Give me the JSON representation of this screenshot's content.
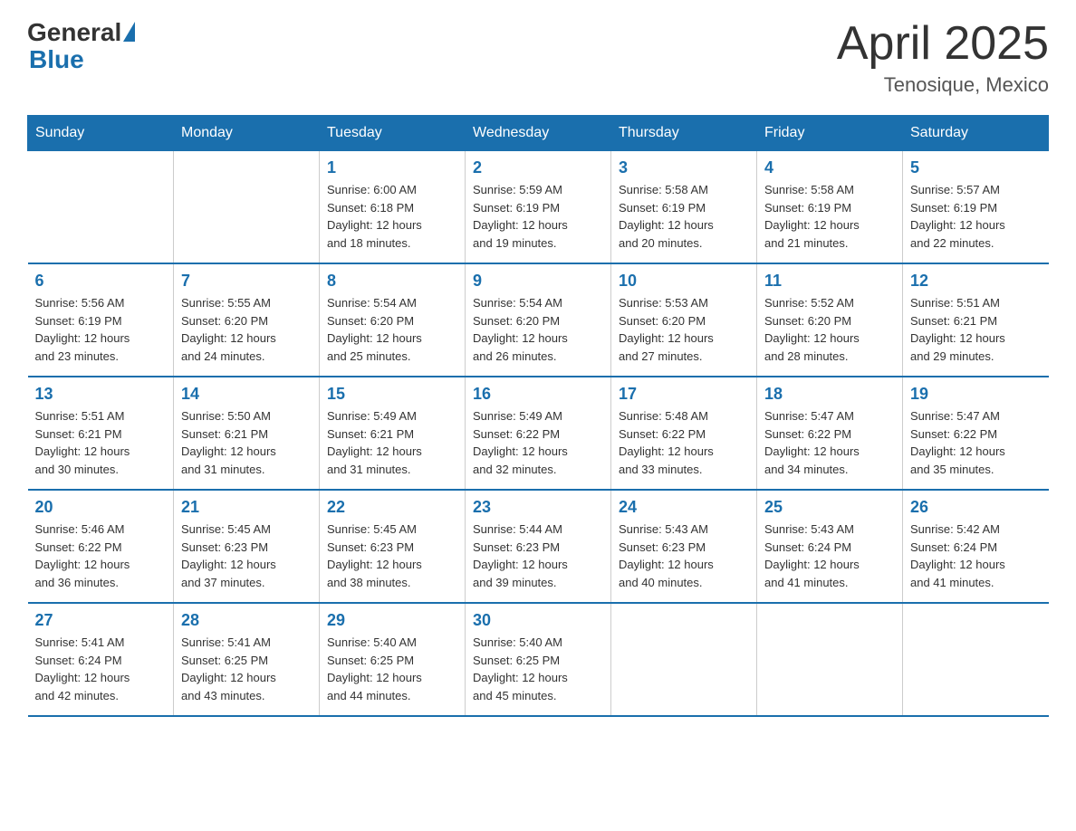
{
  "logo": {
    "general": "General",
    "blue": "Blue"
  },
  "header": {
    "title": "April 2025",
    "subtitle": "Tenosique, Mexico"
  },
  "weekdays": [
    "Sunday",
    "Monday",
    "Tuesday",
    "Wednesday",
    "Thursday",
    "Friday",
    "Saturday"
  ],
  "weeks": [
    [
      {
        "day": "",
        "info": ""
      },
      {
        "day": "",
        "info": ""
      },
      {
        "day": "1",
        "info": "Sunrise: 6:00 AM\nSunset: 6:18 PM\nDaylight: 12 hours\nand 18 minutes."
      },
      {
        "day": "2",
        "info": "Sunrise: 5:59 AM\nSunset: 6:19 PM\nDaylight: 12 hours\nand 19 minutes."
      },
      {
        "day": "3",
        "info": "Sunrise: 5:58 AM\nSunset: 6:19 PM\nDaylight: 12 hours\nand 20 minutes."
      },
      {
        "day": "4",
        "info": "Sunrise: 5:58 AM\nSunset: 6:19 PM\nDaylight: 12 hours\nand 21 minutes."
      },
      {
        "day": "5",
        "info": "Sunrise: 5:57 AM\nSunset: 6:19 PM\nDaylight: 12 hours\nand 22 minutes."
      }
    ],
    [
      {
        "day": "6",
        "info": "Sunrise: 5:56 AM\nSunset: 6:19 PM\nDaylight: 12 hours\nand 23 minutes."
      },
      {
        "day": "7",
        "info": "Sunrise: 5:55 AM\nSunset: 6:20 PM\nDaylight: 12 hours\nand 24 minutes."
      },
      {
        "day": "8",
        "info": "Sunrise: 5:54 AM\nSunset: 6:20 PM\nDaylight: 12 hours\nand 25 minutes."
      },
      {
        "day": "9",
        "info": "Sunrise: 5:54 AM\nSunset: 6:20 PM\nDaylight: 12 hours\nand 26 minutes."
      },
      {
        "day": "10",
        "info": "Sunrise: 5:53 AM\nSunset: 6:20 PM\nDaylight: 12 hours\nand 27 minutes."
      },
      {
        "day": "11",
        "info": "Sunrise: 5:52 AM\nSunset: 6:20 PM\nDaylight: 12 hours\nand 28 minutes."
      },
      {
        "day": "12",
        "info": "Sunrise: 5:51 AM\nSunset: 6:21 PM\nDaylight: 12 hours\nand 29 minutes."
      }
    ],
    [
      {
        "day": "13",
        "info": "Sunrise: 5:51 AM\nSunset: 6:21 PM\nDaylight: 12 hours\nand 30 minutes."
      },
      {
        "day": "14",
        "info": "Sunrise: 5:50 AM\nSunset: 6:21 PM\nDaylight: 12 hours\nand 31 minutes."
      },
      {
        "day": "15",
        "info": "Sunrise: 5:49 AM\nSunset: 6:21 PM\nDaylight: 12 hours\nand 31 minutes."
      },
      {
        "day": "16",
        "info": "Sunrise: 5:49 AM\nSunset: 6:22 PM\nDaylight: 12 hours\nand 32 minutes."
      },
      {
        "day": "17",
        "info": "Sunrise: 5:48 AM\nSunset: 6:22 PM\nDaylight: 12 hours\nand 33 minutes."
      },
      {
        "day": "18",
        "info": "Sunrise: 5:47 AM\nSunset: 6:22 PM\nDaylight: 12 hours\nand 34 minutes."
      },
      {
        "day": "19",
        "info": "Sunrise: 5:47 AM\nSunset: 6:22 PM\nDaylight: 12 hours\nand 35 minutes."
      }
    ],
    [
      {
        "day": "20",
        "info": "Sunrise: 5:46 AM\nSunset: 6:22 PM\nDaylight: 12 hours\nand 36 minutes."
      },
      {
        "day": "21",
        "info": "Sunrise: 5:45 AM\nSunset: 6:23 PM\nDaylight: 12 hours\nand 37 minutes."
      },
      {
        "day": "22",
        "info": "Sunrise: 5:45 AM\nSunset: 6:23 PM\nDaylight: 12 hours\nand 38 minutes."
      },
      {
        "day": "23",
        "info": "Sunrise: 5:44 AM\nSunset: 6:23 PM\nDaylight: 12 hours\nand 39 minutes."
      },
      {
        "day": "24",
        "info": "Sunrise: 5:43 AM\nSunset: 6:23 PM\nDaylight: 12 hours\nand 40 minutes."
      },
      {
        "day": "25",
        "info": "Sunrise: 5:43 AM\nSunset: 6:24 PM\nDaylight: 12 hours\nand 41 minutes."
      },
      {
        "day": "26",
        "info": "Sunrise: 5:42 AM\nSunset: 6:24 PM\nDaylight: 12 hours\nand 41 minutes."
      }
    ],
    [
      {
        "day": "27",
        "info": "Sunrise: 5:41 AM\nSunset: 6:24 PM\nDaylight: 12 hours\nand 42 minutes."
      },
      {
        "day": "28",
        "info": "Sunrise: 5:41 AM\nSunset: 6:25 PM\nDaylight: 12 hours\nand 43 minutes."
      },
      {
        "day": "29",
        "info": "Sunrise: 5:40 AM\nSunset: 6:25 PM\nDaylight: 12 hours\nand 44 minutes."
      },
      {
        "day": "30",
        "info": "Sunrise: 5:40 AM\nSunset: 6:25 PM\nDaylight: 12 hours\nand 45 minutes."
      },
      {
        "day": "",
        "info": ""
      },
      {
        "day": "",
        "info": ""
      },
      {
        "day": "",
        "info": ""
      }
    ]
  ]
}
